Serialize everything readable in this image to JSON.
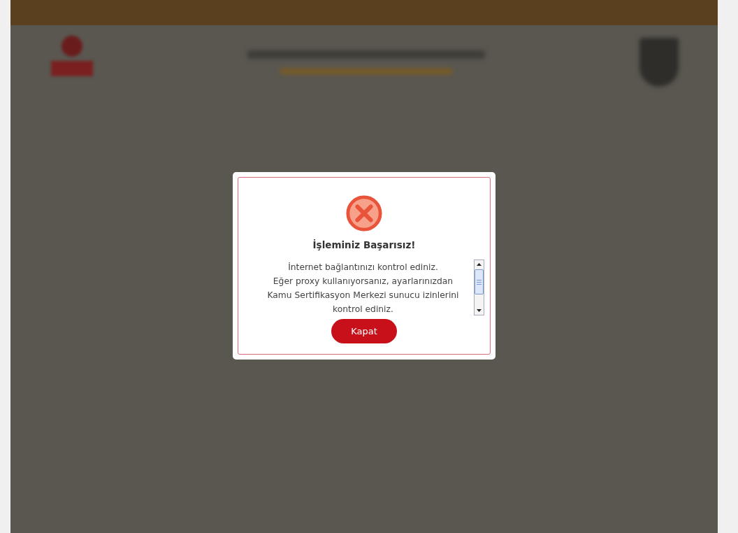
{
  "dialog": {
    "kind": "error",
    "title": "İşleminiz Başarısız!",
    "message_lines": [
      "İnternet bağlantınızı kontrol ediniz.",
      "Eğer proxy kullanıyorsanız, ayarlarınızdan",
      "Kamu Sertifikasyon Merkezi sunucu izinlerini",
      "kontrol ediniz."
    ],
    "buttons": [
      "Kapat"
    ]
  }
}
